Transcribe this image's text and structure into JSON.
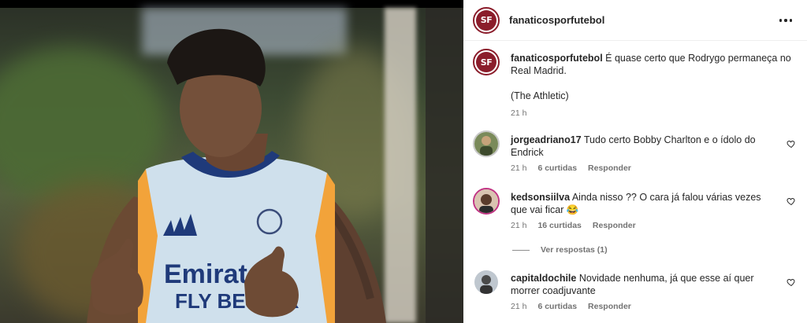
{
  "media": {
    "alt": "Foto do jogador em treino"
  },
  "post": {
    "username": "fanaticosporfutebol",
    "avatar_text": "SF",
    "caption_username": "fanaticosporfutebol",
    "caption_text": "É quase certo que Rodrygo permaneça no Real Madrid.",
    "caption_source": "(The Athletic)",
    "caption_time": "21 h"
  },
  "comments": [
    {
      "username": "jorgeadriano17",
      "text": "Tudo certo Bobby Charlton e o ídolo do Endrick",
      "time": "21 h",
      "likes": "6 curtidas",
      "reply": "Responder"
    },
    {
      "username": "kedsonsiilva",
      "text": "Ainda nisso ?? O cara já falou várias vezes que vai ficar 😂",
      "time": "21 h",
      "likes": "16 curtidas",
      "reply": "Responder",
      "view_replies": "Ver respostas (1)"
    },
    {
      "username": "capitaldochile",
      "text": "Novidade nenhuma, já que esse aí quer morrer coadjuvante",
      "time": "21 h",
      "likes": "6 curtidas",
      "reply": "Responder"
    }
  ],
  "icons": {
    "more": "more-options-icon",
    "heart": "heart-outline-icon"
  },
  "colors": {
    "brand": "#8b1d2b",
    "text": "#262626",
    "muted": "#737373",
    "border": "#efefef"
  }
}
